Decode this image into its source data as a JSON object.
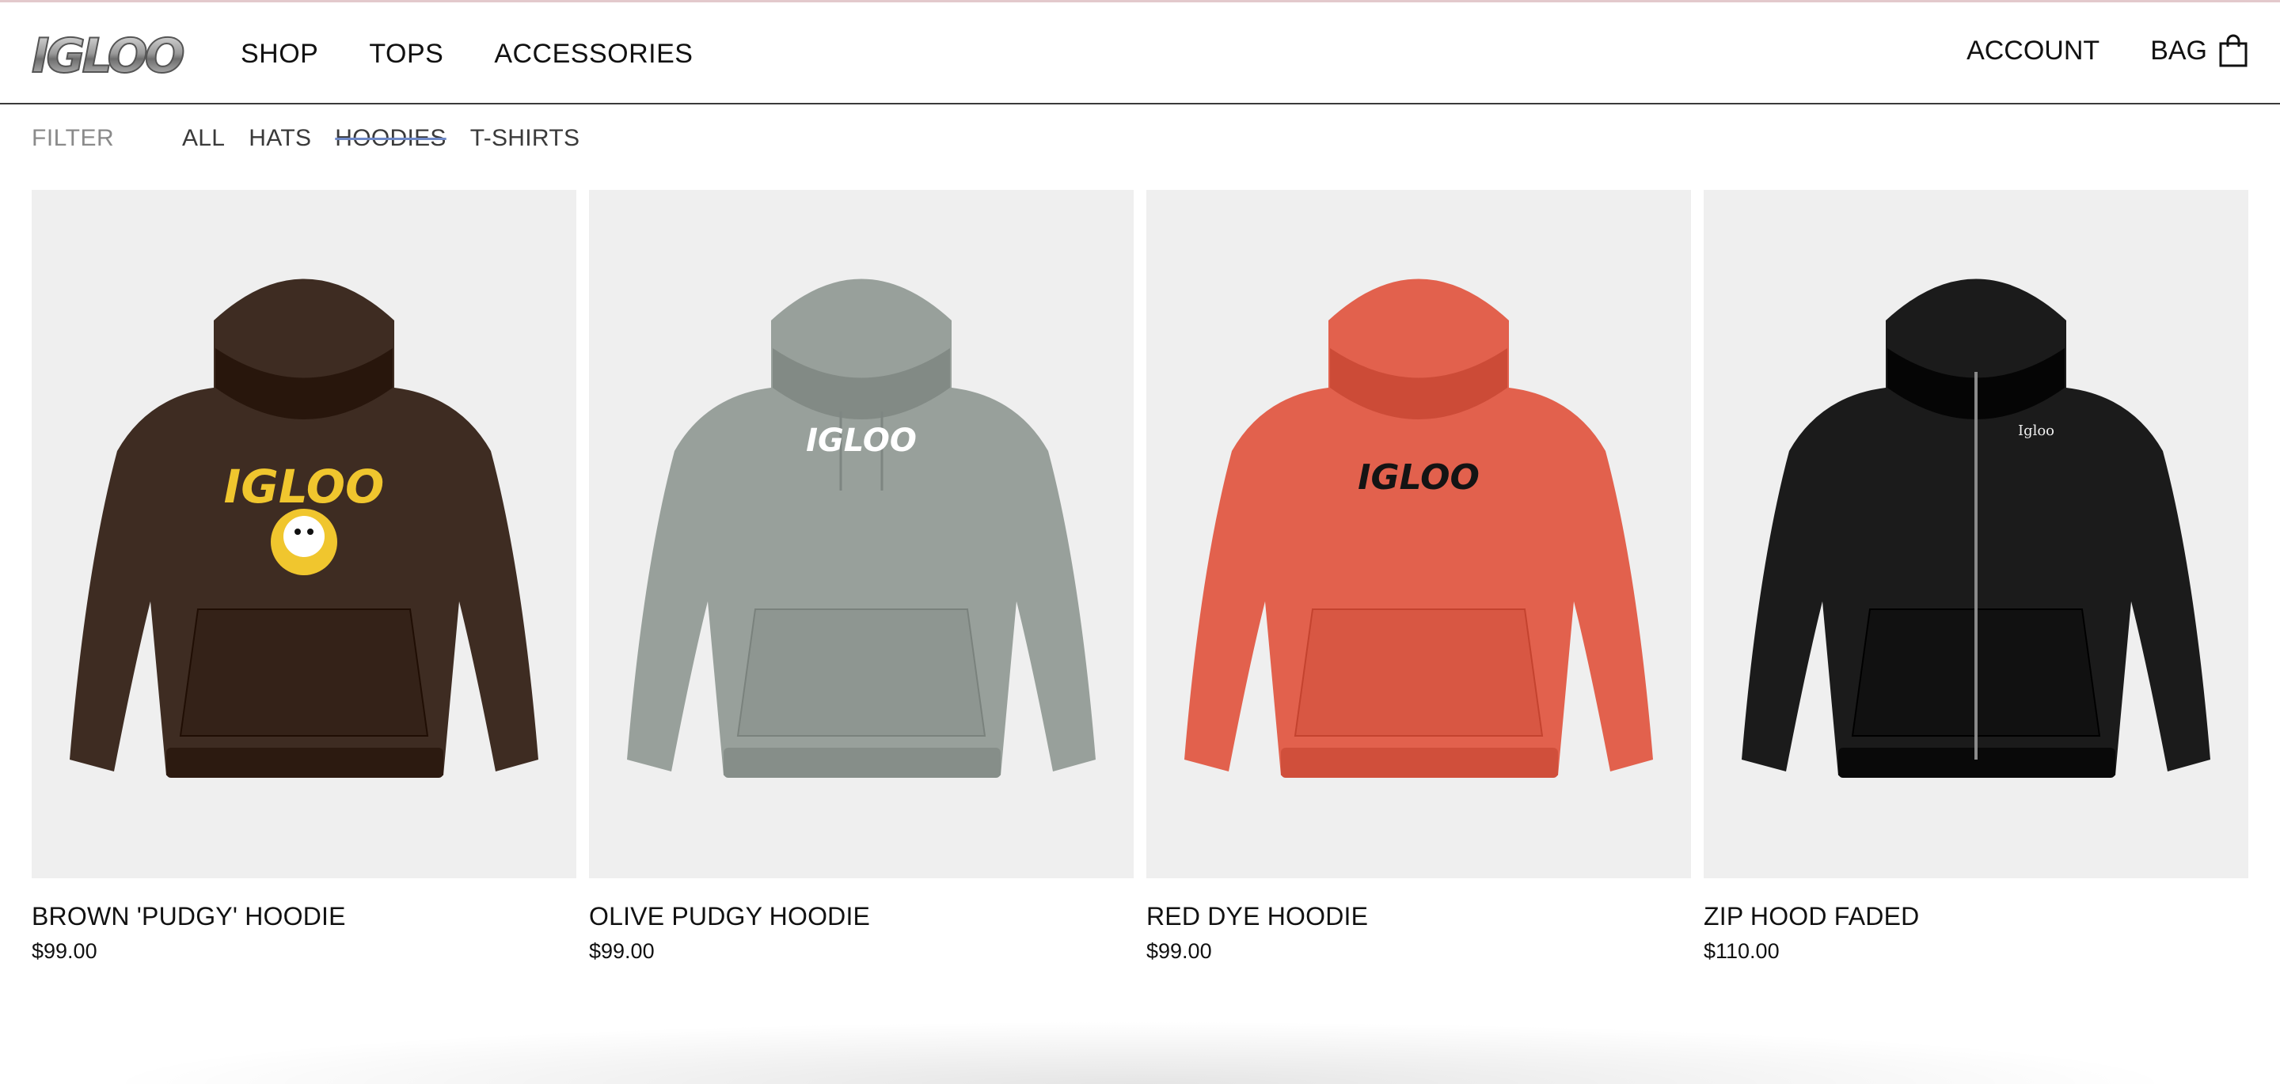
{
  "header": {
    "logo_text": "IGLOO",
    "nav": [
      "SHOP",
      "TOPS",
      "ACCESSORIES"
    ],
    "account_label": "ACCOUNT",
    "bag_label": "BAG"
  },
  "filter": {
    "label": "FILTER",
    "items": [
      "ALL",
      "HATS",
      "HOODIES",
      "T-SHIRTS"
    ],
    "active": "HOODIES"
  },
  "products": [
    {
      "name": "BROWN 'PUDGY' HOODIE",
      "price": "$99.00",
      "color": "#3e2c22",
      "graphic": "IGLOO",
      "graphic_color": "#f0c62e"
    },
    {
      "name": "OLIVE PUDGY HOODIE",
      "price": "$99.00",
      "color": "#98a09b",
      "graphic": "IGLOO",
      "graphic_color": "#ffffff"
    },
    {
      "name": "RED DYE HOODIE",
      "price": "$99.00",
      "color": "#e2614d",
      "graphic": "IGLOO",
      "graphic_color": "#141414"
    },
    {
      "name": "ZIP HOOD FADED",
      "price": "$110.00",
      "color": "#1b1b1b",
      "graphic": "Igloo",
      "graphic_color": "#eeeeee"
    }
  ],
  "icons": {
    "bag": "shopping-bag-icon"
  },
  "colors": {
    "filter_active_strike": "#6f89c8",
    "header_rule": "#3a3a3a",
    "card_bg": "#efefef"
  }
}
